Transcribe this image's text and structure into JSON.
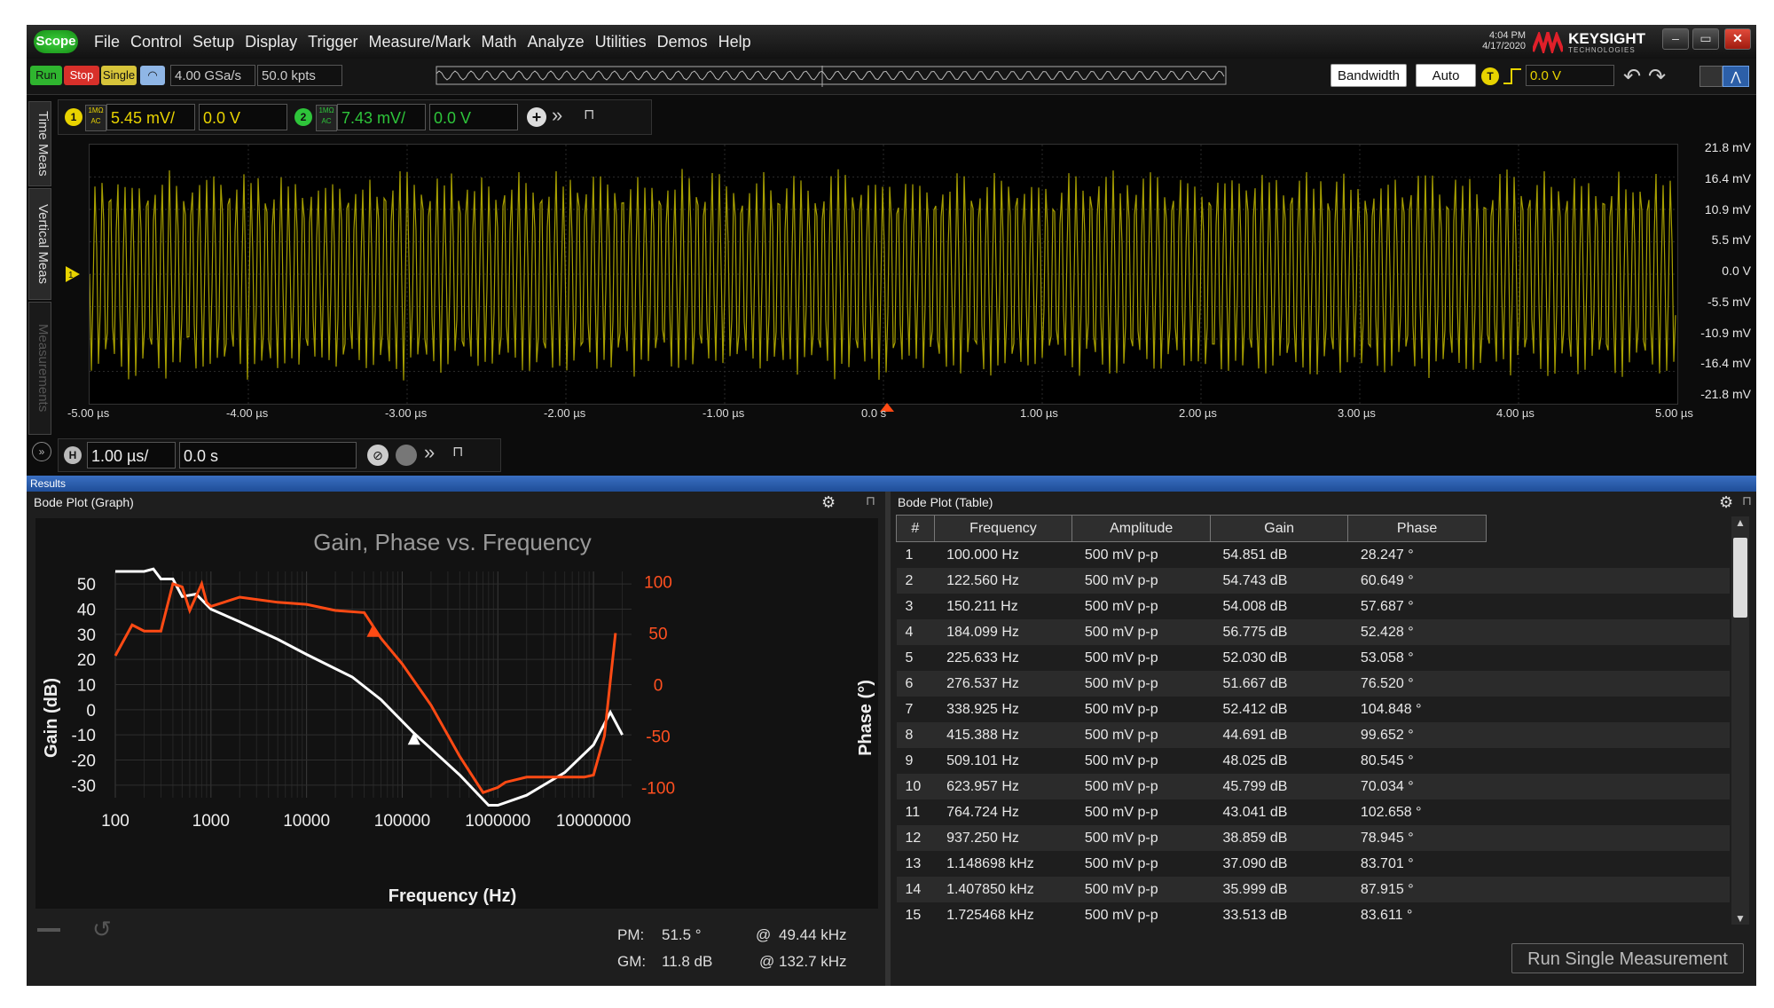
{
  "menubar": {
    "logo": "Scope",
    "items": [
      "File",
      "Control",
      "Setup",
      "Display",
      "Trigger",
      "Measure/Mark",
      "Math",
      "Analyze",
      "Utilities",
      "Demos",
      "Help"
    ],
    "time": "4:04 PM",
    "date": "4/17/2020",
    "brand": "KEYSIGHT",
    "brand_sub": "TECHNOLOGIES"
  },
  "toolbar": {
    "run": "Run",
    "stop": "Stop",
    "single": "Single",
    "sample_rate": "4.00 GSa/s",
    "memory_depth": "50.0 kpts",
    "bandwidth": "Bandwidth",
    "auto": "Auto",
    "trigger_badge": "T",
    "trigger_level": "0.0 V"
  },
  "sidetabs": {
    "time_meas": "Time Meas",
    "vertical_meas": "Vertical Meas",
    "measurements": "Measurements"
  },
  "channels": {
    "ch1": {
      "num": "1",
      "coupling_top": "1MΩ",
      "coupling_bot": "AC",
      "scale": "5.45 mV/",
      "offset": "0.0 V",
      "color": "#e8d300"
    },
    "ch2": {
      "num": "2",
      "coupling_top": "1MΩ",
      "coupling_bot": "AC",
      "scale": "7.43 mV/",
      "offset": "0.0 V",
      "color": "#2ec43a"
    }
  },
  "waveform": {
    "y_labels": [
      "21.8 mV",
      "16.4 mV",
      "10.9 mV",
      "5.5 mV",
      "0.0 V",
      "-5.5 mV",
      "-10.9 mV",
      "-16.4 mV",
      "-21.8 mV"
    ],
    "x_labels": [
      "-5.00 µs",
      "-4.00 µs",
      "-3.00 µs",
      "-2.00 µs",
      "-1.00 µs",
      "0.0 s",
      "1.00 µs",
      "2.00 µs",
      "3.00 µs",
      "4.00 µs",
      "5.00 µs"
    ],
    "channel_marker": "1",
    "trace_color": "#a8a000"
  },
  "timebase": {
    "badge": "H",
    "scale": "1.00 µs/",
    "position": "0.0 s"
  },
  "results": {
    "header": "Results",
    "graph_title": "Bode Plot (Graph)",
    "table_title": "Bode Plot (Table)",
    "run_single": "Run Single Measurement"
  },
  "margins": {
    "pm_label": "PM:",
    "pm_value": "51.5 °",
    "pm_at": "@",
    "pm_freq": "49.44 kHz",
    "gm_label": "GM:",
    "gm_value": "11.8 dB",
    "gm_at": "@",
    "gm_freq": "132.7 kHz"
  },
  "table": {
    "columns": [
      "#",
      "Frequency",
      "Amplitude",
      "Gain",
      "Phase"
    ],
    "rows": [
      [
        "1",
        "100.000 Hz",
        "500 mV p-p",
        "54.851 dB",
        "28.247 °"
      ],
      [
        "2",
        "122.560 Hz",
        "500 mV p-p",
        "54.743 dB",
        "60.649 °"
      ],
      [
        "3",
        "150.211 Hz",
        "500 mV p-p",
        "54.008 dB",
        "57.687 °"
      ],
      [
        "4",
        "184.099 Hz",
        "500 mV p-p",
        "56.775 dB",
        "52.428 °"
      ],
      [
        "5",
        "225.633 Hz",
        "500 mV p-p",
        "52.030 dB",
        "53.058 °"
      ],
      [
        "6",
        "276.537 Hz",
        "500 mV p-p",
        "51.667 dB",
        "76.520 °"
      ],
      [
        "7",
        "338.925 Hz",
        "500 mV p-p",
        "52.412 dB",
        "104.848 °"
      ],
      [
        "8",
        "415.388 Hz",
        "500 mV p-p",
        "44.691 dB",
        "99.652 °"
      ],
      [
        "9",
        "509.101 Hz",
        "500 mV p-p",
        "48.025 dB",
        "80.545 °"
      ],
      [
        "10",
        "623.957 Hz",
        "500 mV p-p",
        "45.799 dB",
        "70.034 °"
      ],
      [
        "11",
        "764.724 Hz",
        "500 mV p-p",
        "43.041 dB",
        "102.658 °"
      ],
      [
        "12",
        "937.250 Hz",
        "500 mV p-p",
        "38.859 dB",
        "78.945 °"
      ],
      [
        "13",
        "1.148698 kHz",
        "500 mV p-p",
        "37.090 dB",
        "83.701 °"
      ],
      [
        "14",
        "1.407850 kHz",
        "500 mV p-p",
        "35.999 dB",
        "87.915 °"
      ],
      [
        "15",
        "1.725468 kHz",
        "500 mV p-p",
        "33.513 dB",
        "83.611 °"
      ]
    ]
  },
  "chart_data": {
    "type": "line",
    "title": "Gain, Phase vs. Frequency",
    "xlabel": "Frequency (Hz)",
    "ylabel": "Gain (dB)",
    "y2label": "Phase (°)",
    "x_scale": "log",
    "x_ticks": [
      "100",
      "1000",
      "10000",
      "100000",
      "1000000",
      "10000000"
    ],
    "y_ticks": [
      "50",
      "40",
      "30",
      "20",
      "10",
      "0",
      "-10",
      "-20",
      "-30"
    ],
    "y2_ticks": [
      "100",
      "50",
      "0",
      "-50",
      "-100"
    ],
    "ylim": [
      -35,
      55
    ],
    "y2lim": [
      -110,
      110
    ],
    "grid": true,
    "series": [
      {
        "color": "#ffffff",
        "axis": "left",
        "x": [
          100,
          200,
          250,
          300,
          400,
          500,
          700,
          1000,
          2000,
          5000,
          10000,
          30000,
          60000,
          130000,
          400000,
          800000,
          1000000,
          2000000,
          5000000,
          10000000,
          15000000,
          20000000
        ],
        "y": [
          55,
          55,
          56,
          52,
          52,
          45,
          46,
          40,
          35,
          28,
          22,
          13,
          4,
          -9,
          -26,
          -38,
          -38,
          -34,
          -25,
          -14,
          -1,
          -10
        ]
      },
      {
        "color": "#ff4a14",
        "axis": "right",
        "x": [
          100,
          150,
          200,
          300,
          400,
          500,
          600,
          800,
          900,
          1000,
          2000,
          5000,
          10000,
          20000,
          40000,
          60000,
          100000,
          200000,
          400000,
          700000,
          1000000,
          1200000,
          2000000,
          5000000,
          8000000,
          10000000,
          13000000,
          17000000
        ],
        "y": [
          28,
          58,
          52,
          52,
          98,
          95,
          72,
          98,
          80,
          76,
          85,
          80,
          78,
          72,
          70,
          45,
          20,
          -20,
          -70,
          -105,
          -100,
          -95,
          -90,
          -90,
          -90,
          -88,
          -50,
          50
        ]
      }
    ],
    "markers": [
      {
        "series": 1,
        "x": 49440,
        "y": 51.5
      },
      {
        "series": 0,
        "x": 132700,
        "y": -11.8
      }
    ]
  }
}
